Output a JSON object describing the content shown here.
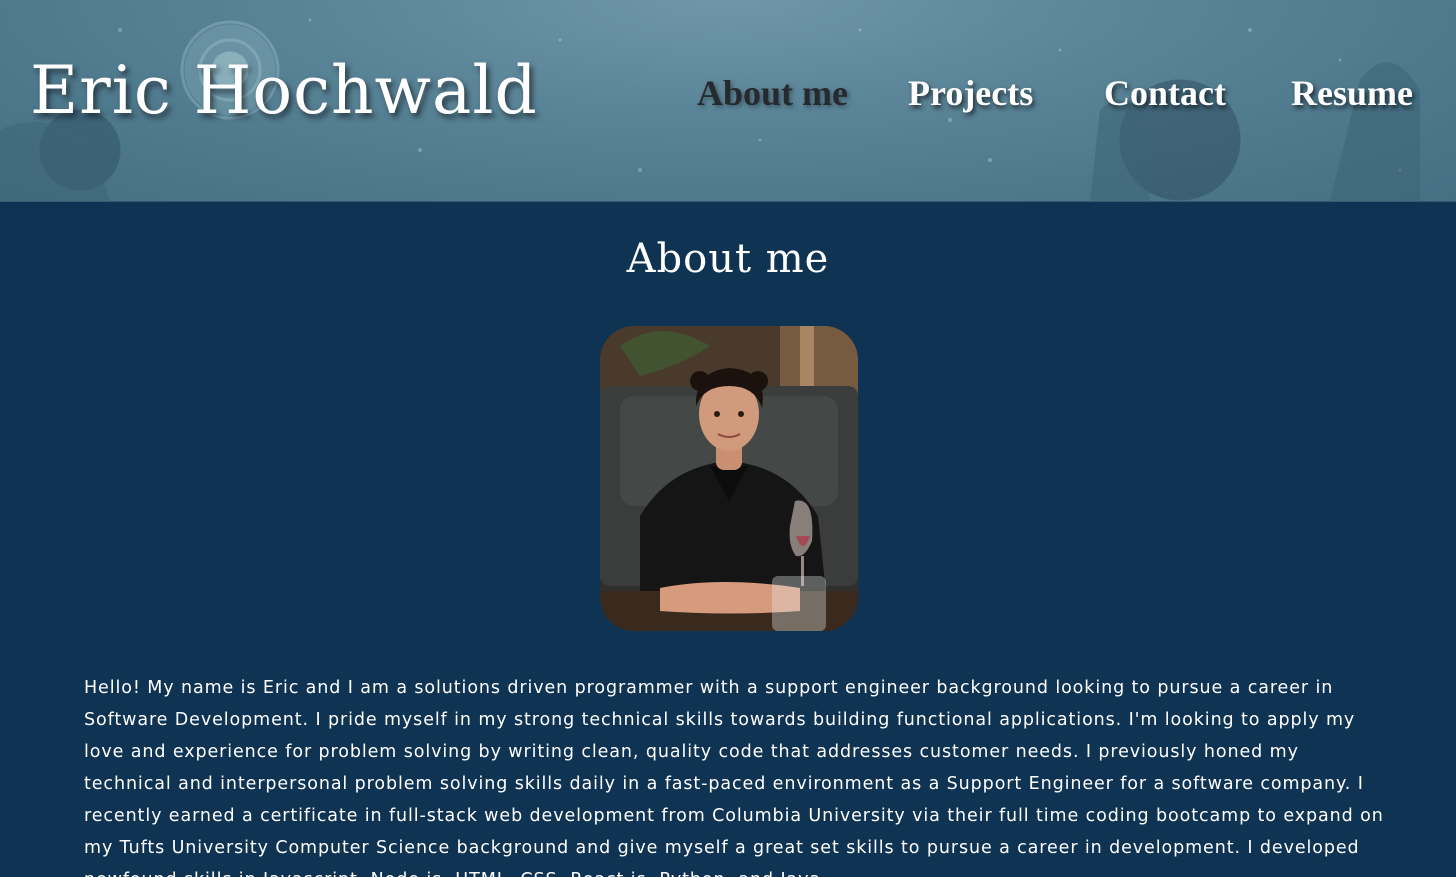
{
  "header": {
    "site_title": "Eric Hochwald",
    "nav": [
      {
        "label": "About me",
        "active": true
      },
      {
        "label": "Projects",
        "active": false
      },
      {
        "label": "Contact",
        "active": false
      },
      {
        "label": "Resume",
        "active": false
      }
    ]
  },
  "main": {
    "section_title": "About me",
    "photo_icon": "profile-photo",
    "bio": "Hello! My name is Eric and I am a solutions driven programmer with a support engineer background looking to pursue a career in Software Development. I pride myself in my strong technical skills towards building functional applications. I'm looking to apply my love and experience for problem solving by writing clean, quality code that addresses customer needs. I previously honed my technical and interpersonal problem solving skills daily in a fast-paced environment as a Support Engineer for a software company. I recently earned a certificate in full-stack web development from Columbia University via their full time coding bootcamp to expand on my Tufts University Computer Science background and give myself a great set skills to pursue a career in development. I developed newfound skills in Javascript, Node.js, HTML, CSS, React.js, Python, and Java."
  },
  "colors": {
    "page_background": "#0f3352",
    "header_background": "#5a8497",
    "active_nav": "#262a2e",
    "text": "#ffffff"
  }
}
